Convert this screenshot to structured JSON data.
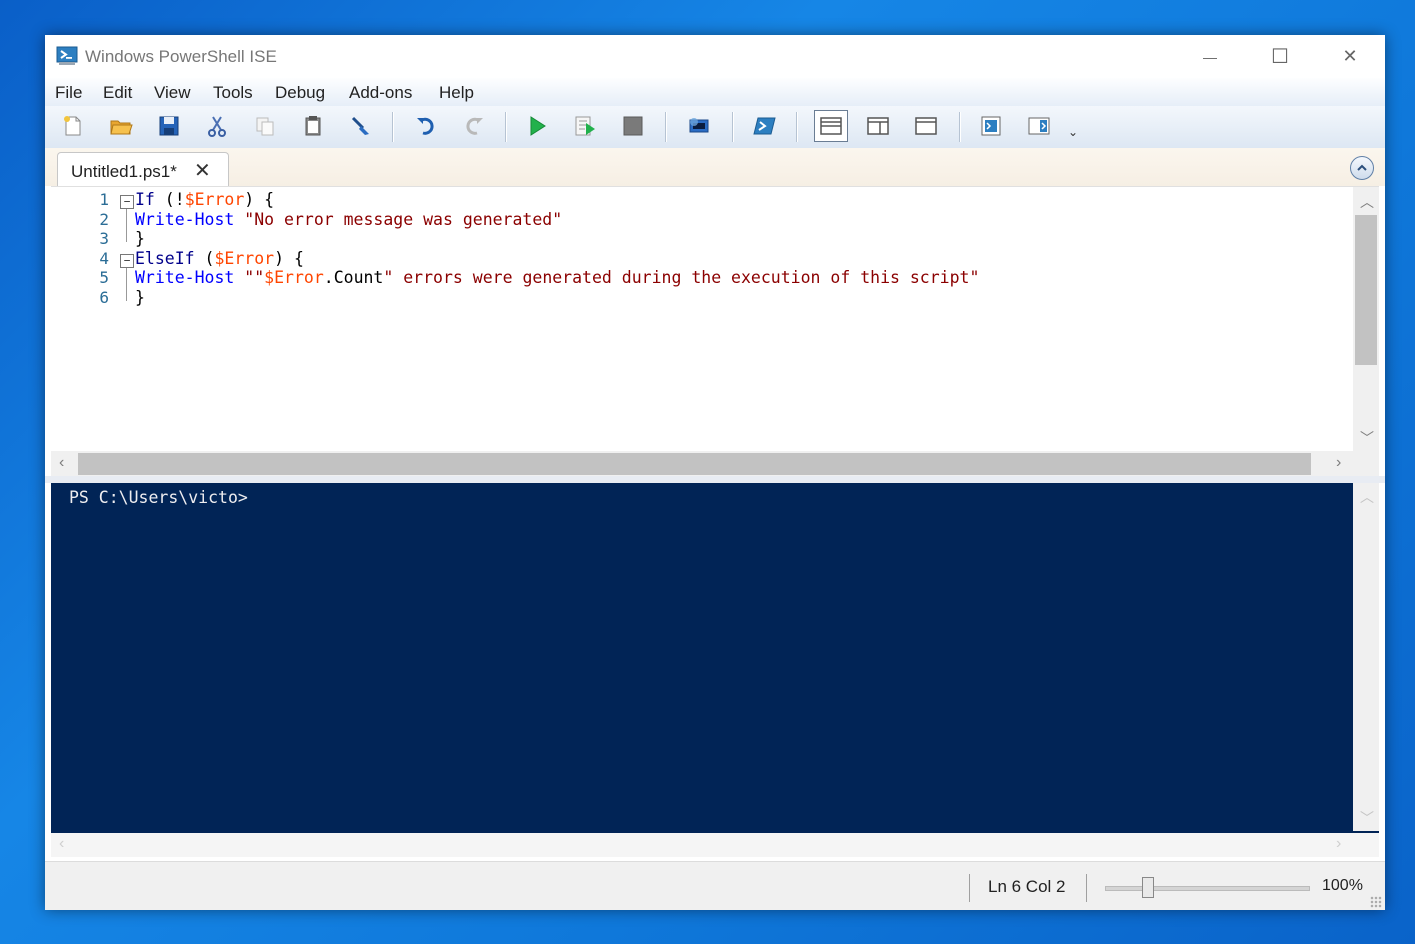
{
  "window": {
    "title": "Windows PowerShell ISE",
    "controls": {
      "minimize": "—",
      "maximize": "☐",
      "close": "✕"
    }
  },
  "menu": [
    "File",
    "Edit",
    "View",
    "Tools",
    "Debug",
    "Add-ons",
    "Help"
  ],
  "toolbar": {
    "buttons": [
      "new-script",
      "open",
      "save",
      "cut",
      "copy",
      "paste",
      "clear-console",
      "undo",
      "redo",
      "run-script",
      "run-selection",
      "stop",
      "new-remote-powershell-tab",
      "start-powershell-exe",
      "show-script-pane-top",
      "show-script-pane-right",
      "show-script-pane-maximized",
      "show-command-window",
      "show-command-add-on"
    ]
  },
  "tabs": [
    {
      "label": "Untitled1.ps1*",
      "close": "✕"
    }
  ],
  "editor": {
    "line_numbers": [
      "1",
      "2",
      "3",
      "4",
      "5",
      "6"
    ],
    "lines": [
      [
        {
          "t": "If",
          "c": "kw"
        },
        {
          "t": " (!",
          "c": ""
        },
        {
          "t": "$Error",
          "c": "var"
        },
        {
          "t": ") {",
          "c": ""
        }
      ],
      [
        {
          "t": "Write-Host",
          "c": "cmd"
        },
        {
          "t": " ",
          "c": ""
        },
        {
          "t": "\"No error message was generated\"",
          "c": "str"
        }
      ],
      [
        {
          "t": "}",
          "c": ""
        }
      ],
      [
        {
          "t": "ElseIf",
          "c": "kw"
        },
        {
          "t": " (",
          "c": ""
        },
        {
          "t": "$Error",
          "c": "var"
        },
        {
          "t": ") {",
          "c": ""
        }
      ],
      [
        {
          "t": "Write-Host",
          "c": "cmd"
        },
        {
          "t": " ",
          "c": ""
        },
        {
          "t": "\"\"",
          "c": "str"
        },
        {
          "t": "$Error",
          "c": "var"
        },
        {
          "t": ".Count",
          "c": ""
        },
        {
          "t": "\" errors were generated during the execution of this script\"",
          "c": "str"
        }
      ],
      [
        {
          "t": "}",
          "c": ""
        }
      ]
    ]
  },
  "console": {
    "prompt": "PS C:\\Users\\victo>"
  },
  "status": {
    "position": "Ln 6  Col 2",
    "zoom": "100%",
    "zoom_level_percent": 100
  },
  "colors": {
    "console_bg": "#012456",
    "keyword": "#00008b",
    "command": "#0000ff",
    "string": "#8b0000",
    "variable": "#ff4500"
  }
}
